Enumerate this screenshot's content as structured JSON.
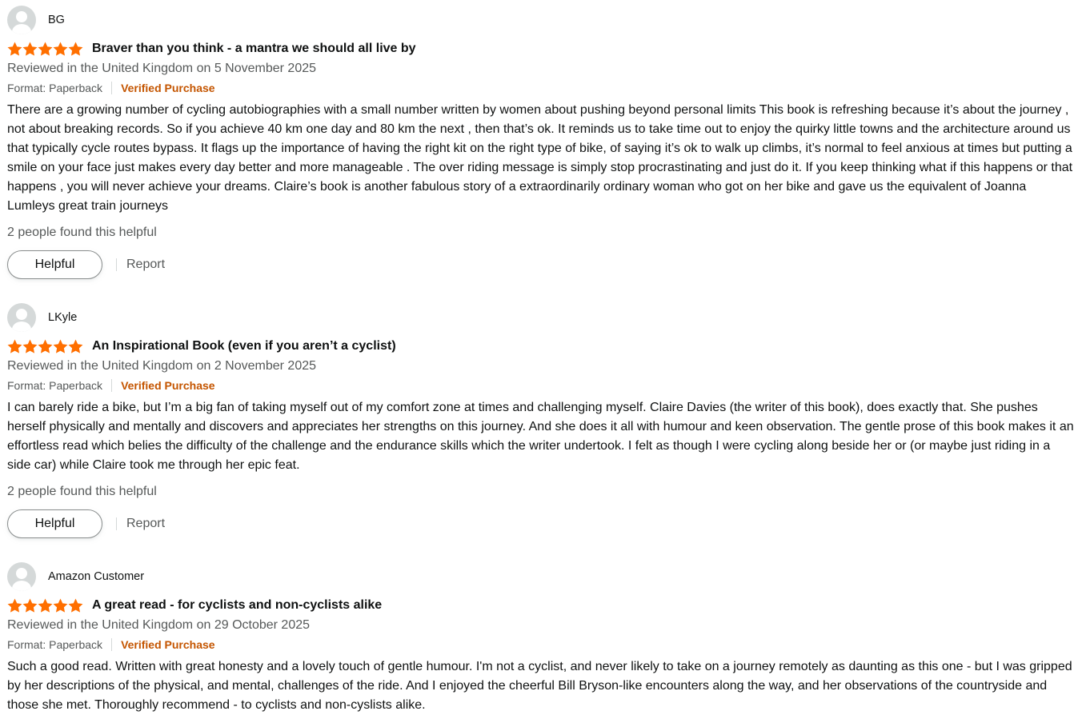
{
  "reviews": [
    {
      "profile_name": "BG",
      "rating": 5,
      "title": "Braver than you think - a mantra we should all live by",
      "date": "Reviewed in the United Kingdom on 5 November 2025",
      "format": "Format: Paperback",
      "verified": "Verified Purchase",
      "body": "There are a growing number of cycling autobiographies with a small number written by women about pushing beyond personal limits This book is refreshing because it’s about the journey , not about breaking records. So if you achieve 40 km one day and 80 km the next , then that’s ok. It reminds us to take time out to enjoy the quirky little towns and the architecture around us that typically cycle routes bypass. It flags up the importance of having the right kit on the right type of bike, of saying it’s ok to walk up climbs, it’s normal to feel anxious at times but putting a smile on your face just makes every day better and more manageable . The over riding message is simply stop procrastinating and just do it. If you keep thinking what if this happens or that happens , you will never achieve your dreams. Claire’s book is another fabulous story of a extraordinarily ordinary woman who got on her bike and gave us the equivalent of Joanna Lumleys great train journeys",
      "helpful_count": "2 people found this helpful",
      "helpful_label": "Helpful",
      "report_label": "Report"
    },
    {
      "profile_name": "LKyle",
      "rating": 5,
      "title": "An Inspirational Book (even if you aren’t a cyclist)",
      "date": "Reviewed in the United Kingdom on 2 November 2025",
      "format": "Format: Paperback",
      "verified": "Verified Purchase",
      "body": "I can barely ride a bike, but I’m a big fan of taking myself out of my comfort zone at times and challenging myself. Claire Davies (the writer of this book), does exactly that. She pushes herself physically and mentally and discovers and appreciates her strengths on this journey. And she does it all with humour and keen observation. The gentle prose of this book makes it an effortless read which belies the difficulty of the challenge and the endurance skills which the writer undertook. I felt as though I were cycling along beside her or (or maybe just riding in a side car) while Claire took me through her epic feat.",
      "helpful_count": "2 people found this helpful",
      "helpful_label": "Helpful",
      "report_label": "Report"
    },
    {
      "profile_name": "Amazon Customer",
      "rating": 5,
      "title": "A great read - for cyclists and non-cyclists alike",
      "date": "Reviewed in the United Kingdom on 29 October 2025",
      "format": "Format: Paperback",
      "verified": "Verified Purchase",
      "body": "Such a good read. Written with great honesty and a lovely touch of gentle humour. I'm not a cyclist, and never likely to take on a journey remotely as daunting as this one - but I was gripped by her descriptions of the physical, and mental, challenges of the ride. And I enjoyed the cheerful Bill Bryson-like encounters along the way, and her observations of the countryside and those she met. Thoroughly recommend - to cyclists and non-cyslists alike."
    }
  ],
  "colors": {
    "star": "#ff6f00",
    "verified": "#c45500",
    "muted_text": "#565959",
    "avatar_bg": "#d5d9d9"
  }
}
